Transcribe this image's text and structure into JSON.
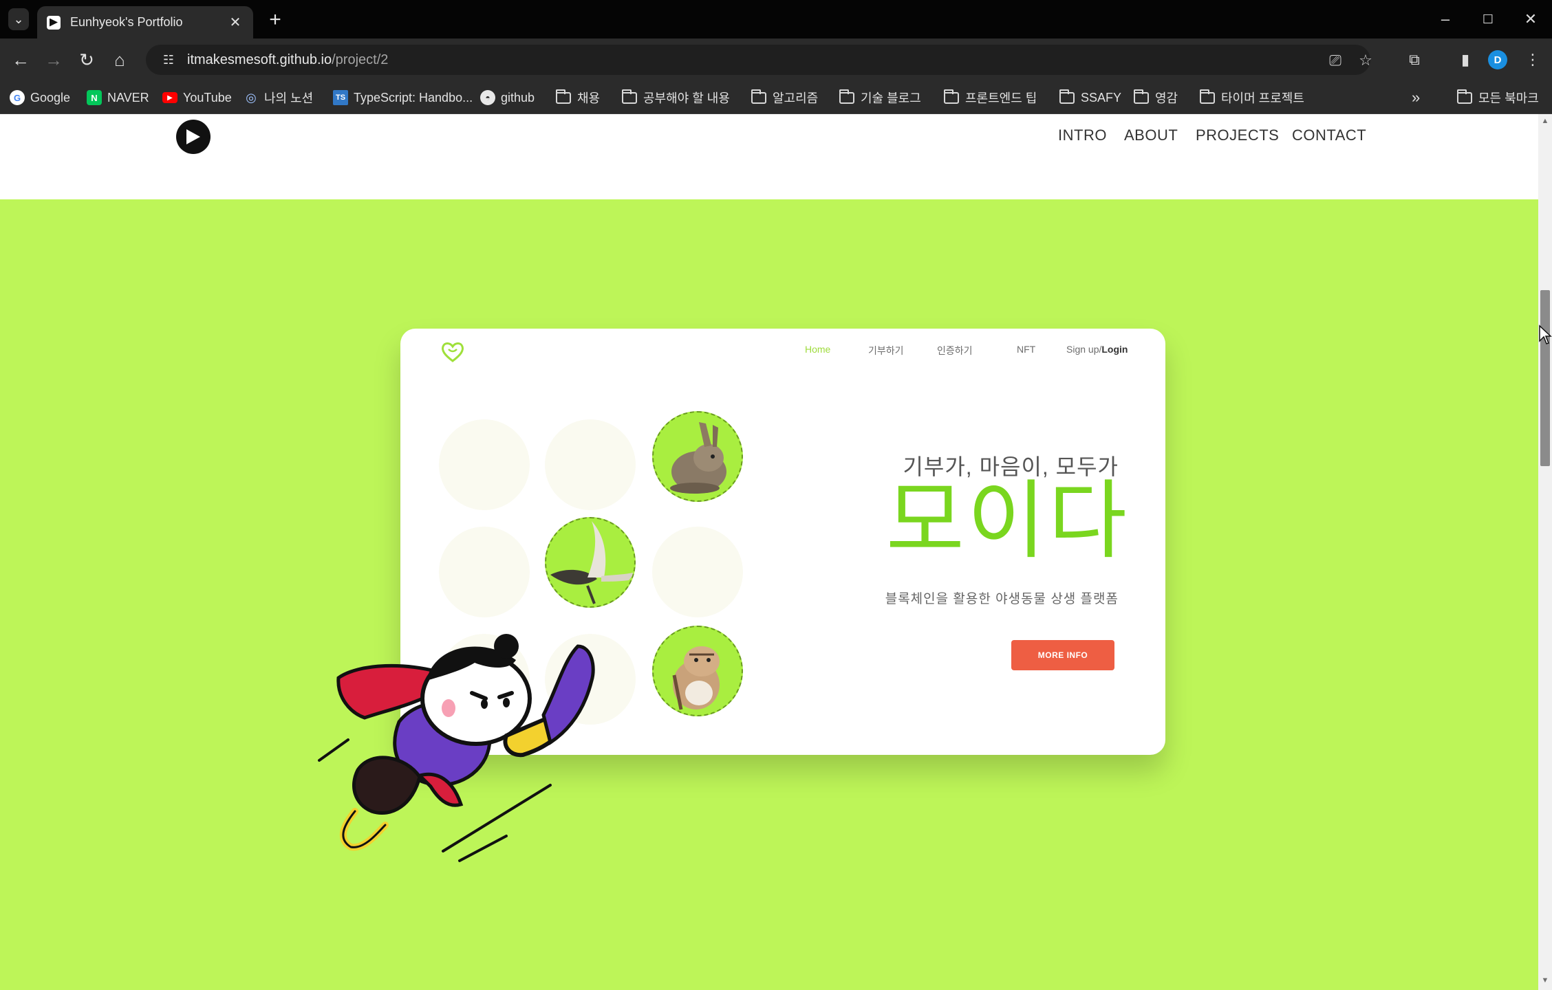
{
  "browser": {
    "tab_title": "Eunhyeok's Portfolio",
    "url_host": "itmakesmesoft.github.io",
    "url_path": "/project/2",
    "profile_initial": "D",
    "bookmarks": [
      {
        "label": "Google",
        "icon": "google-icon"
      },
      {
        "label": "NAVER",
        "icon": "naver-icon"
      },
      {
        "label": "YouTube",
        "icon": "youtube-icon"
      },
      {
        "label": "나의 노션",
        "icon": "globe-icon"
      },
      {
        "label": "TypeScript: Handbo...",
        "icon": "typescript-icon"
      },
      {
        "label": "github",
        "icon": "github-icon"
      },
      {
        "label": "채용",
        "icon": "folder-icon"
      },
      {
        "label": "공부해야 할 내용",
        "icon": "folder-icon"
      },
      {
        "label": "알고리즘",
        "icon": "folder-icon"
      },
      {
        "label": "기술 블로그",
        "icon": "folder-icon"
      },
      {
        "label": "프론트엔드 팁",
        "icon": "folder-icon"
      },
      {
        "label": "SSAFY",
        "icon": "folder-icon"
      },
      {
        "label": "영감",
        "icon": "folder-icon"
      },
      {
        "label": "타이머 프로젝트",
        "icon": "folder-icon"
      }
    ],
    "all_bookmarks": "모든 북마크"
  },
  "site": {
    "nav": [
      "INTRO",
      "ABOUT",
      "PROJECTS",
      "CONTACT"
    ]
  },
  "mockup": {
    "nav": {
      "home": "Home",
      "donate": "기부하기",
      "certify": "인증하기",
      "nft": "NFT",
      "signup": "Sign up/",
      "login": "Login"
    },
    "subtitle": "기부가, 마음이, 모두가",
    "title": "모이다",
    "description": "블록체인을 활용한 야생동물 상생 플랫폼",
    "button": "MORE INFO"
  },
  "colors": {
    "section_bg": "#bdf558",
    "title_green": "#7ad61f",
    "button_red": "#ee5e43"
  }
}
